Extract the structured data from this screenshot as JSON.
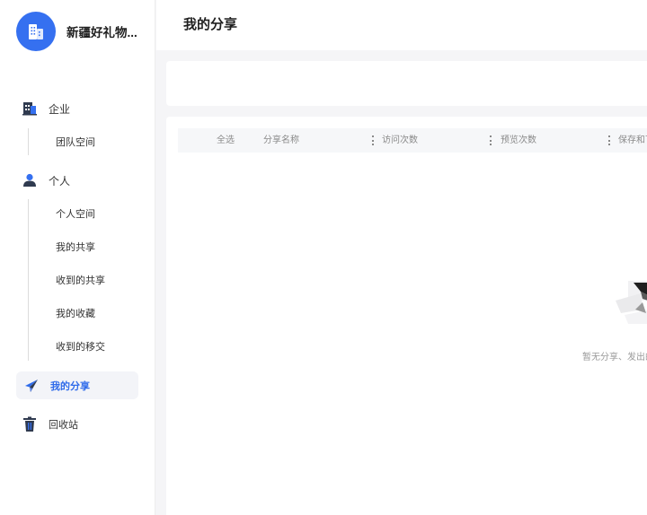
{
  "sidebar": {
    "org_name": "新疆好礼物...",
    "enterprise": {
      "label": "企业",
      "items": [
        {
          "label": "团队空间"
        }
      ]
    },
    "personal": {
      "label": "个人",
      "items": [
        {
          "label": "个人空间"
        },
        {
          "label": "我的共享"
        },
        {
          "label": "收到的共享"
        },
        {
          "label": "我的收藏"
        },
        {
          "label": "收到的移交"
        }
      ]
    },
    "my_share": {
      "label": "我的分享"
    },
    "trash": {
      "label": "回收站"
    }
  },
  "header": {
    "title": "我的分享"
  },
  "table": {
    "select_all": "全选",
    "columns": [
      "分享名称",
      "访问次数",
      "预览次数",
      "保存和下"
    ]
  },
  "empty_state": {
    "text": "暂无分享、发出的"
  },
  "colors": {
    "accent": "#2f6bea",
    "avatar_bg": "#3570f0"
  }
}
